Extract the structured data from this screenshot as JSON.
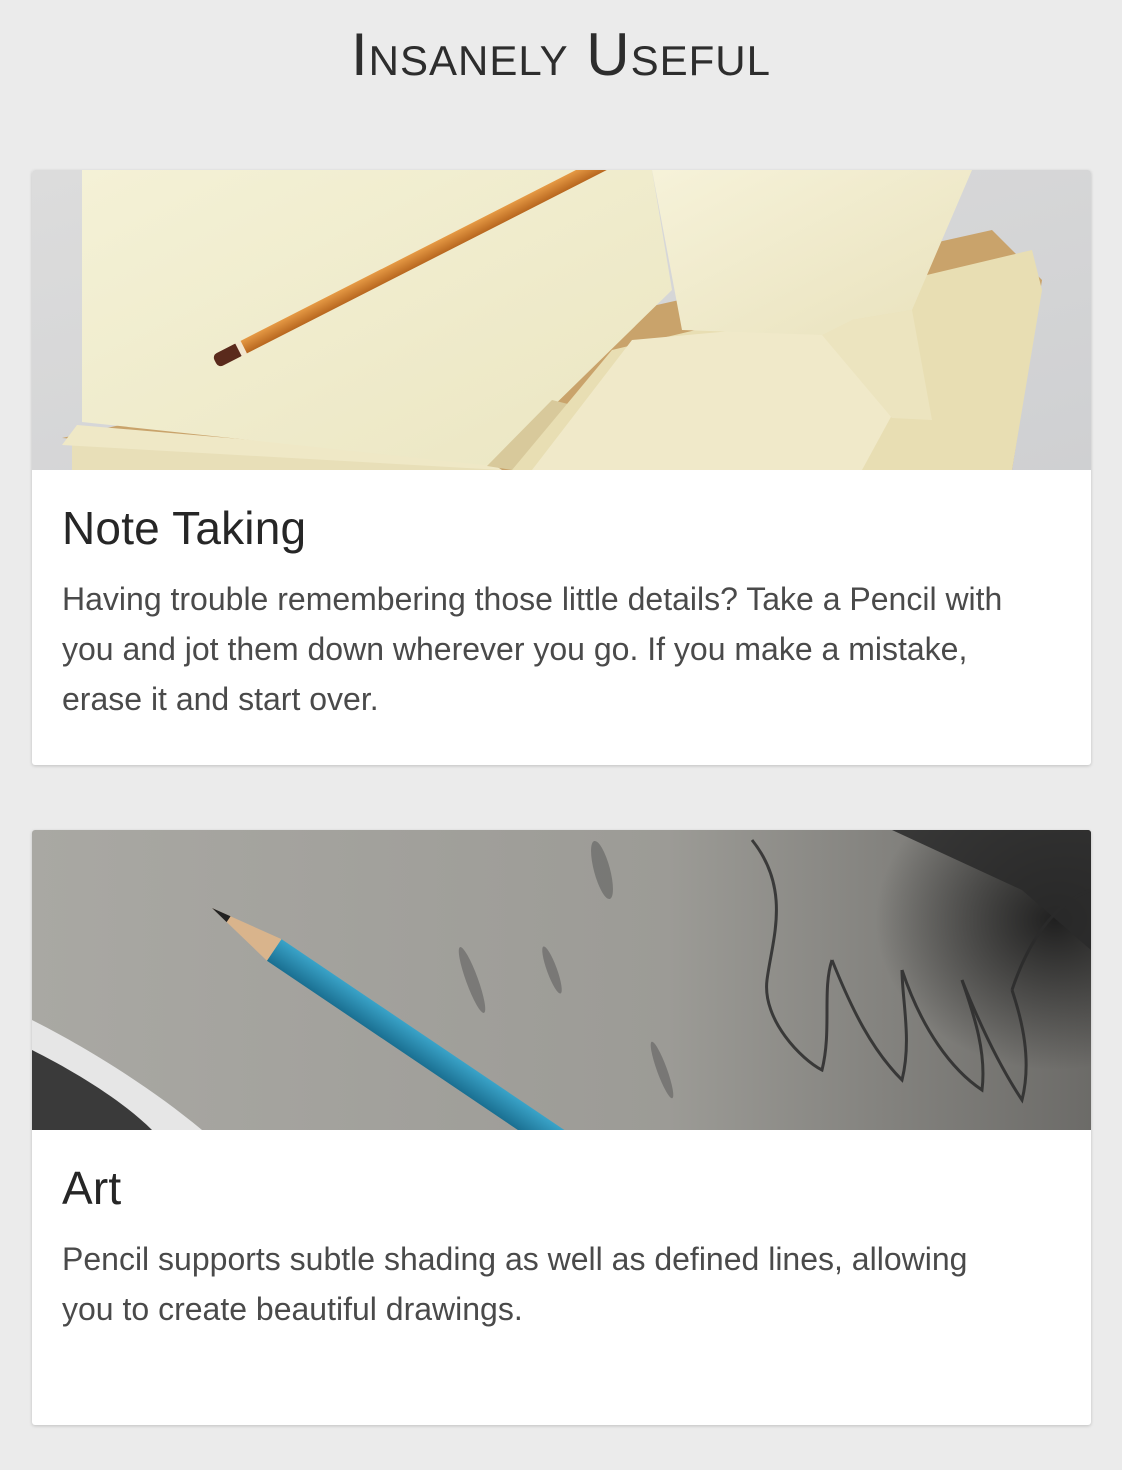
{
  "header": {
    "title": "Insanely Useful"
  },
  "cards": [
    {
      "title": "Note Taking",
      "text": "Having trouble remembering those little details? Take a Pencil with you and jot them down wherever you go. If you make a mistake, erase it and start over.",
      "image_subject": "notebook-with-pencil"
    },
    {
      "title": "Art",
      "text": "Pencil supports subtle shading as well as defined lines, allowing you to create beautiful drawings.",
      "image_subject": "sketch-with-blue-pencil"
    }
  ]
}
